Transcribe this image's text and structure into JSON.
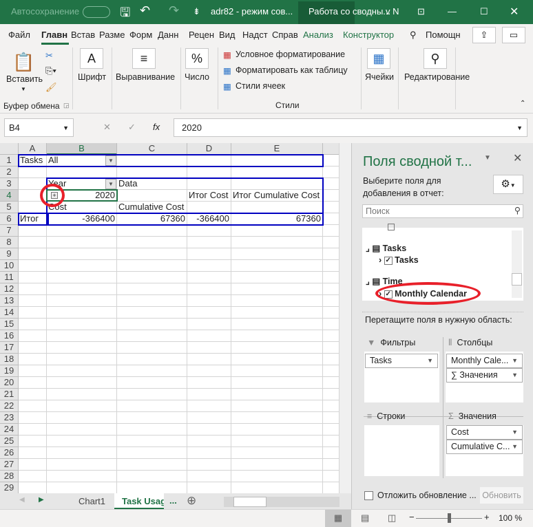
{
  "titlebar": {
    "autosave": "Автосохранение",
    "filename": "adr82  -  режим сов...",
    "context_tab": "Работа со сводны...",
    "user": "v N"
  },
  "tabs": [
    "Файл",
    "Главн",
    "Встав",
    "Разме",
    "Форм",
    "Данн",
    "Рецен",
    "Вид",
    "Надст",
    "Справ",
    "Анализ",
    "Конструктор"
  ],
  "search_label": "Помощн",
  "ribbon": {
    "paste": "Вставить",
    "clipboard": "Буфер обмена",
    "font": "Шрифт",
    "align": "Выравнивание",
    "number": "Число",
    "cond_format": "Условное форматирование",
    "format_table": "Форматировать как таблицу",
    "cell_styles": "Стили ячеек",
    "styles": "Стили",
    "cells": "Ячейки",
    "editing": "Редактирование"
  },
  "formula": {
    "name_box": "B4",
    "fx": "fx",
    "value": "2020"
  },
  "grid": {
    "columns": [
      "A",
      "B",
      "C",
      "D",
      "E"
    ],
    "rows": 29,
    "cells": {
      "A1": "Tasks",
      "B1": "All",
      "B3": "Year",
      "C3": "Data",
      "B4": "2020",
      "D4": "Итог Cost",
      "E4": "Итог Cumulative Cost",
      "B5": "Cost",
      "C5": "Cumulative Cost",
      "A6": "Итог",
      "B6": "-366400",
      "C6": "67360",
      "D6": "-366400",
      "E6": "67360"
    }
  },
  "sheet_tabs": [
    "Chart1",
    "Task Usag"
  ],
  "sheet_more": "...",
  "pane": {
    "title": "Поля сводной т...",
    "subtitle": "Выберите поля для добавления в отчет:",
    "search_placeholder": "Поиск",
    "tables": [
      {
        "name": "Tasks",
        "field": "Tasks",
        "checked": true
      },
      {
        "name": "Time",
        "field": "Monthly Calendar",
        "checked": true
      }
    ],
    "drag_label": "Перетащите поля в нужную область:",
    "filters": {
      "label": "Фильтры",
      "items": [
        "Tasks"
      ]
    },
    "columns": {
      "label": "Столбцы",
      "items": [
        "Monthly Cale...",
        "∑ Значения"
      ]
    },
    "rows": {
      "label": "Строки",
      "items": []
    },
    "values": {
      "label": "Значения",
      "items": [
        "Cost",
        "Cumulative C..."
      ]
    },
    "defer": "Отложить обновление ...",
    "update": "Обновить"
  },
  "status": {
    "zoom": "100 %"
  },
  "colors": {
    "brand": "#217346",
    "pivot_border": "#0000c0",
    "highlight": "#e8202a"
  }
}
